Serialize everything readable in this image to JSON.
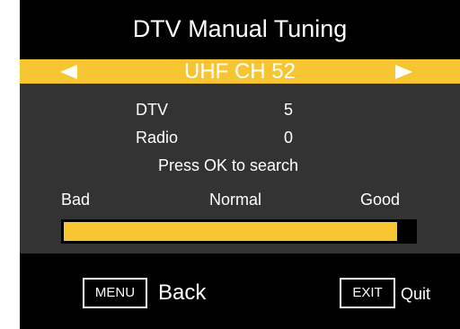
{
  "screen": {
    "title": "DTV Manual Tuning",
    "accent_color": "#f7c531",
    "panel_color": "#333333"
  },
  "channel_selector": {
    "label": "UHF CH 52",
    "left_arrow_icon": "triangle-left-icon",
    "right_arrow_icon": "triangle-right-icon"
  },
  "scan_results": [
    {
      "label": "DTV",
      "value": "5"
    },
    {
      "label": "Radio",
      "value": "0"
    }
  ],
  "prompt": "Press OK to search",
  "signal_meter": {
    "labels": {
      "bad": "Bad",
      "normal": "Normal",
      "good": "Good"
    },
    "level_fraction": 0.95
  },
  "footer": {
    "menu_key": "MENU",
    "back_label": "Back",
    "exit_key": "EXIT",
    "quit_label": "Quit"
  }
}
